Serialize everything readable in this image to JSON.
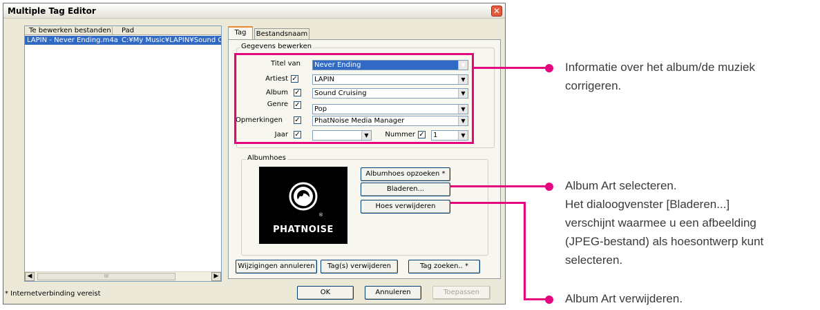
{
  "window": {
    "title": "Multiple Tag Editor",
    "close_symbol": "✕"
  },
  "file_list": {
    "columns": [
      "Te bewerken bestanden",
      "Pad"
    ],
    "rows": [
      [
        "LAPIN - Never Ending.m4a",
        "C:¥My Music¥LAPIN¥Sound Cruising"
      ]
    ],
    "scroll_track": "III"
  },
  "tabs": [
    "Tag",
    "Bestandsnaam"
  ],
  "edit_group": {
    "label": "Gegevens bewerken",
    "fields": {
      "title_label": "Titel van",
      "title_value": "Never Ending",
      "artist_label": "Artiest",
      "artist_value": "LAPIN",
      "album_label": "Album",
      "album_value": "Sound Cruising",
      "genre_label": "Genre",
      "genre_value": "Pop",
      "comment_label": "Opmerkingen",
      "comment_value": "PhatNoise Media Manager",
      "year_label": "Jaar",
      "year_value": "",
      "track_label": "Nummer",
      "track_value": "1"
    },
    "checkbox_mark": "✓",
    "dropdown_arrow": "▼"
  },
  "art_group": {
    "label": "Albumhoes",
    "logo_text": "PHATNOISE",
    "logo_mark": "®",
    "search_button": "Albumhoes opzoeken *",
    "browse_button": "Bladeren...",
    "remove_button": "Hoes verwijderen"
  },
  "action_buttons": {
    "cancel_changes": "Wijzigingen annuleren",
    "delete_tags": "Tag(s) verwijderen",
    "search_tag": "Tag zoeken.. *"
  },
  "footer": {
    "note": "* Internetverbinding vereist",
    "ok": "OK",
    "cancel": "Annuleren",
    "apply": "Toepassen"
  },
  "annotations": {
    "info_line1": "Informatie over het album/de muziek",
    "info_line2": "corrigeren.",
    "select_line1": "Album Art selecteren.",
    "select_line2": "Het dialoogvenster [Bladeren...]",
    "select_line3": "verschijnt waarmee u een afbeelding",
    "select_line4": "(JPEG-bestand) als hoesontwerp kunt",
    "select_line5": "selecteren.",
    "remove_line1": "Album Art verwijderen."
  },
  "colors": {
    "highlight": "#e5067f",
    "window_bg": "#ece9d8",
    "selection": "#316ac5"
  }
}
